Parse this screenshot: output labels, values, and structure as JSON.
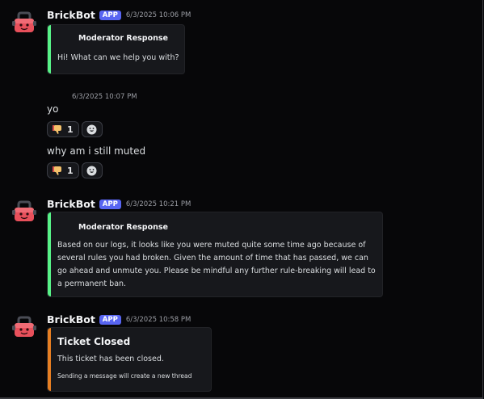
{
  "messages": [
    {
      "author": "BrickBot",
      "badge": "APP",
      "timestamp": "6/3/2025 10:06 PM",
      "embed": {
        "author": "Moderator Response",
        "description": "Hi! What can we help you with?",
        "color": "#57f287"
      }
    },
    {
      "timestamp": "6/3/2025 10:07 PM",
      "lines": [
        {
          "text": "yo",
          "reaction": {
            "emoji": "thumbs-down-icon",
            "count": "1"
          }
        },
        {
          "text": "why am i still muted",
          "reaction": {
            "emoji": "thumbs-down-icon",
            "count": "1"
          }
        }
      ]
    },
    {
      "author": "BrickBot",
      "badge": "APP",
      "timestamp": "6/3/2025 10:21 PM",
      "embed": {
        "author": "Moderator Response",
        "description": "Based on our logs, it looks like you were muted quite some time ago because of several rules you had broken. Given the amount of time that has passed, we can go ahead and unmute you. Please be mindful any further rule-breaking will lead to a permanent ban.",
        "color": "#57f287"
      }
    },
    {
      "author": "BrickBot",
      "badge": "APP",
      "timestamp": "6/3/2025 10:58 PM",
      "embed": {
        "title": "Ticket Closed",
        "description": "This ticket has been closed.",
        "footer": "Sending a message will create a new thread",
        "color": "#e67e22"
      }
    }
  ],
  "colors": {
    "background": "#070709",
    "embed_background": "#17181c",
    "app_badge": "#5865f2",
    "avatar_red": "#e8505b"
  }
}
